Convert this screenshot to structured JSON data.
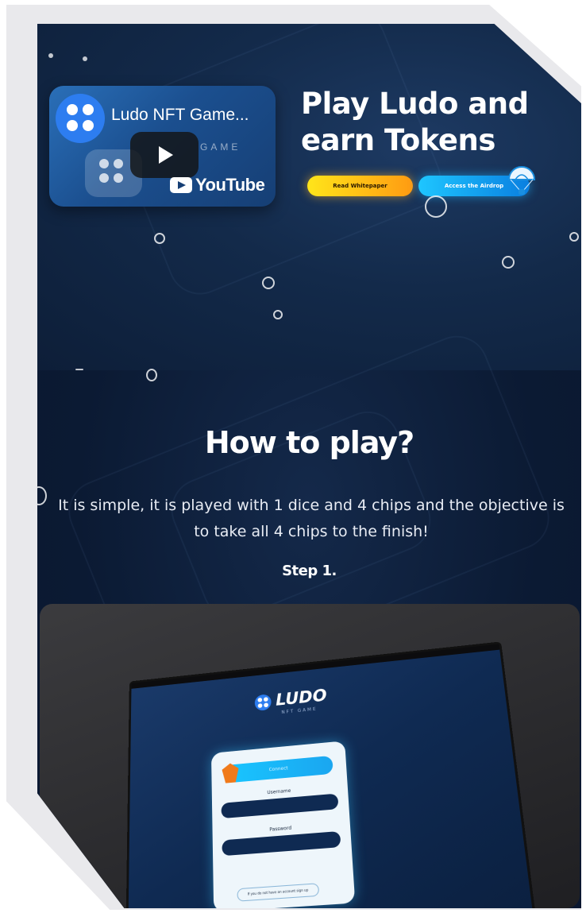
{
  "hero": {
    "title_line1": "Play Ludo and",
    "title_line2": "earn Tokens",
    "buttons": {
      "whitepaper": "Read Whitepaper",
      "airdrop": "Access the Airdrop"
    }
  },
  "video": {
    "title": "Ludo NFT Game...",
    "watermark": "GAME",
    "brand": "YouTube",
    "play_icon": "play-icon"
  },
  "how_to_play": {
    "title": "How to play?",
    "description": "It is simple, it is played with 1 dice and 4 chips and the objective is to take all 4 chips to the finish!",
    "step_label": "Step 1."
  },
  "step_screen": {
    "logo_text": "LUDO",
    "logo_sub": "NFT GAME",
    "connect_label": "Connect",
    "username_label": "Username",
    "password_label": "Password",
    "signup_text": "If you do not have an account sign up"
  },
  "colors": {
    "background": "#0b1a33",
    "whitepaper_gradient": [
      "#ffe51a",
      "#ff9b12"
    ],
    "airdrop_gradient": [
      "#1ec6ff",
      "#0a7fe0"
    ],
    "accent_blue": "#2d7df0"
  }
}
